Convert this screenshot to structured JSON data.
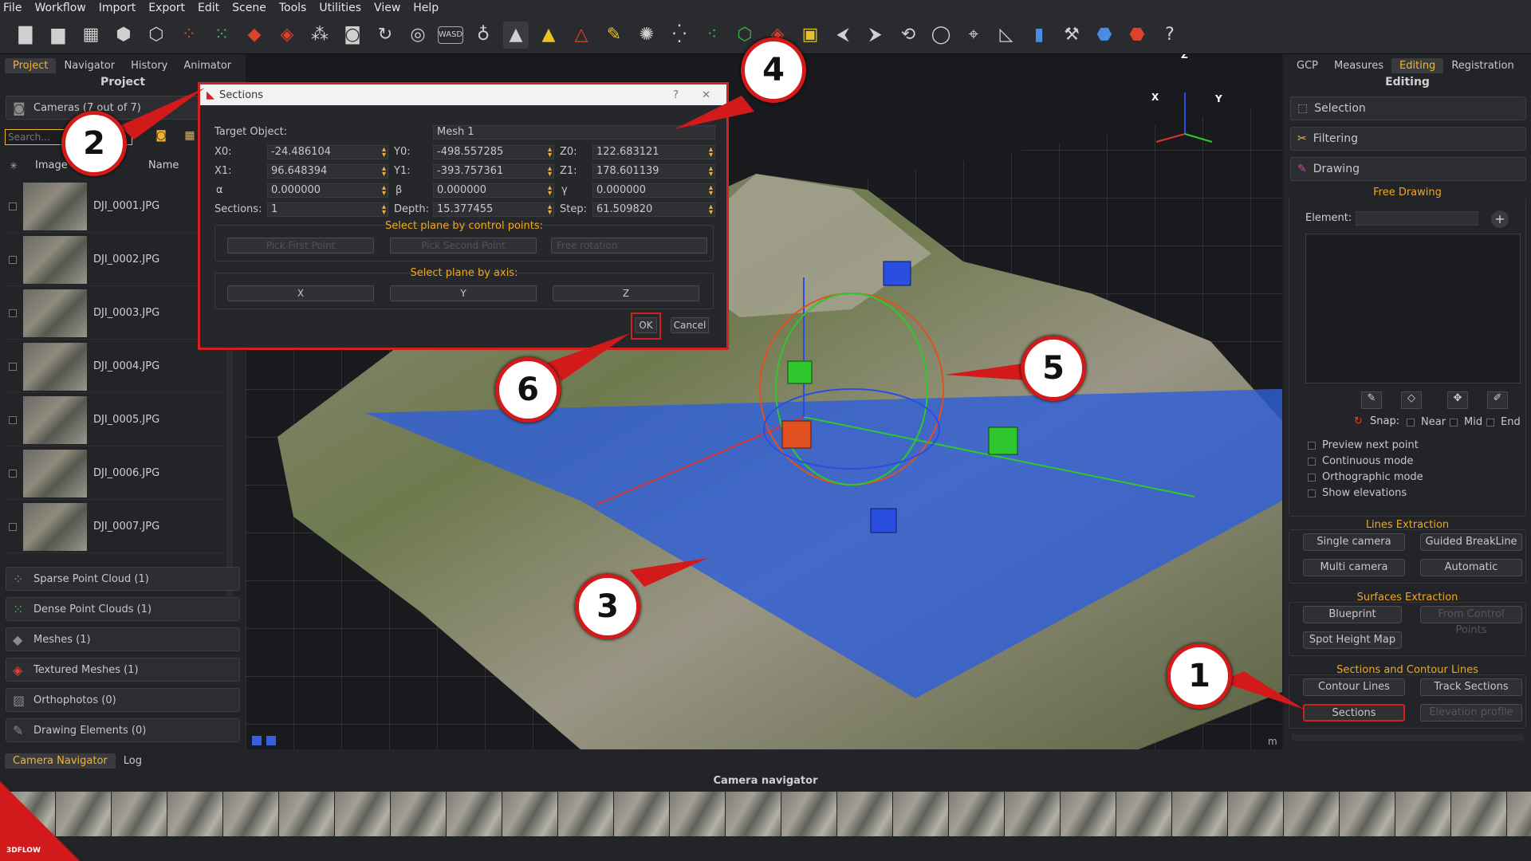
{
  "menu": [
    "File",
    "Workflow",
    "Import",
    "Export",
    "Edit",
    "Scene",
    "Tools",
    "Utilities",
    "View",
    "Help"
  ],
  "left": {
    "tabs": [
      "Project",
      "Navigator",
      "History",
      "Animator"
    ],
    "title": "Project",
    "cameras_label": "Cameras (7 out of 7)",
    "search_placeholder": "Search...",
    "col_image": "Image",
    "col_name": "Name",
    "cameras": [
      "DJI_0001.JPG",
      "DJI_0002.JPG",
      "DJI_0003.JPG",
      "DJI_0004.JPG",
      "DJI_0005.JPG",
      "DJI_0006.JPG",
      "DJI_0007.JPG"
    ],
    "groups": [
      "Sparse Point Cloud (1)",
      "Dense Point Clouds (1)",
      "Meshes (1)",
      "Textured Meshes (1)",
      "Orthophotos (0)",
      "Drawing Elements (0)"
    ]
  },
  "right": {
    "tabs": [
      "GCP",
      "Measures",
      "Editing",
      "Registration"
    ],
    "title": "Editing",
    "tools": [
      "Selection",
      "Filtering",
      "Drawing"
    ],
    "free_drawing": "Free Drawing",
    "element_label": "Element:",
    "snap_label": "Snap:",
    "snap_opts": [
      "Near",
      "Mid",
      "End"
    ],
    "options": [
      "Preview next point",
      "Continuous mode",
      "Orthographic mode",
      "Show elevations"
    ],
    "lines_hdr": "Lines Extraction",
    "lines_btns": [
      "Single camera",
      "Guided BreakLine",
      "Multi camera",
      "Automatic"
    ],
    "surf_hdr": "Surfaces Extraction",
    "surf_btns": [
      "Blueprint",
      "From Control Points",
      "Spot Height Map"
    ],
    "sec_hdr": "Sections and Contour Lines",
    "sec_btns": [
      "Contour Lines",
      "Track Sections",
      "Sections",
      "Elevation profile"
    ]
  },
  "dialog": {
    "title": "Sections",
    "help": "?",
    "target_label": "Target Object:",
    "target_value": "Mesh 1",
    "x0_label": "X0:",
    "x0": "-24.486104",
    "y0_label": "Y0:",
    "y0": "-498.557285",
    "z0_label": "Z0:",
    "z0": "122.683121",
    "x1_label": "X1:",
    "x1": "96.648394",
    "y1_label": "Y1:",
    "y1": "-393.757361",
    "z1_label": "Z1:",
    "z1": "178.601139",
    "a_label": "α",
    "a": "0.000000",
    "b_label": "β",
    "b": "0.000000",
    "g_label": "γ",
    "g": "0.000000",
    "sections_label": "Sections:",
    "sections": "1",
    "depth_label": "Depth:",
    "depth": "15.377455",
    "step_label": "Step:",
    "step": "61.509820",
    "cp_hdr": "Select plane by control points:",
    "cp_btns": [
      "Pick First Point",
      "Pick Second Point",
      "Free rotation"
    ],
    "axis_hdr": "Select plane by axis:",
    "axis_btns": [
      "X",
      "Y",
      "Z"
    ],
    "ok": "OK",
    "cancel": "Cancel"
  },
  "axes": {
    "x": "X",
    "y": "Y",
    "z": "Z"
  },
  "viewport_unit": "m",
  "bottom": {
    "tabs": [
      "Camera Navigator",
      "Log"
    ],
    "title": "Camera navigator"
  },
  "logo": "3DFLOW",
  "callouts": [
    "1",
    "2",
    "3",
    "4",
    "5",
    "6"
  ],
  "colors": {
    "accent": "#f2b42d",
    "highlight": "#d02020",
    "plane": "#2f5fd8"
  }
}
